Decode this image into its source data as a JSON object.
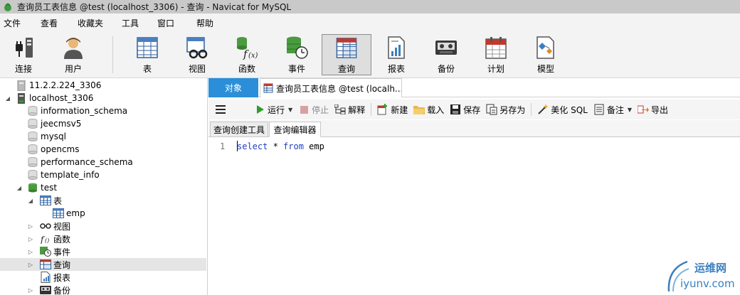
{
  "window": {
    "title": "查询员工表信息 @test (localhost_3306) - 查询 - Navicat for MySQL"
  },
  "menu": [
    "文件",
    "查看",
    "收藏夹",
    "工具",
    "窗口",
    "帮助"
  ],
  "ribbon": [
    {
      "label": "连接",
      "icon": "plug-icon"
    },
    {
      "label": "用户",
      "icon": "user-icon"
    },
    {
      "label": "表",
      "icon": "table-icon"
    },
    {
      "label": "视图",
      "icon": "view-icon"
    },
    {
      "label": "函数",
      "icon": "function-icon"
    },
    {
      "label": "事件",
      "icon": "event-icon"
    },
    {
      "label": "查询",
      "icon": "query-icon",
      "active": true
    },
    {
      "label": "报表",
      "icon": "report-icon"
    },
    {
      "label": "备份",
      "icon": "backup-icon"
    },
    {
      "label": "计划",
      "icon": "schedule-icon"
    },
    {
      "label": "模型",
      "icon": "model-icon"
    }
  ],
  "tree": [
    {
      "label": "11.2.2.224_3306",
      "icon": "server-icon",
      "level": 0,
      "arrow": ""
    },
    {
      "label": "localhost_3306",
      "icon": "server-connected-icon",
      "level": 0,
      "arrow": "expanded"
    },
    {
      "label": "information_schema",
      "icon": "database-icon",
      "level": 1,
      "arrow": ""
    },
    {
      "label": "jeecmsv5",
      "icon": "database-icon",
      "level": 1,
      "arrow": ""
    },
    {
      "label": "mysql",
      "icon": "database-icon",
      "level": 1,
      "arrow": ""
    },
    {
      "label": "opencms",
      "icon": "database-icon",
      "level": 1,
      "arrow": ""
    },
    {
      "label": "performance_schema",
      "icon": "database-icon",
      "level": 1,
      "arrow": ""
    },
    {
      "label": "template_info",
      "icon": "database-icon",
      "level": 1,
      "arrow": ""
    },
    {
      "label": "test",
      "icon": "database-open-icon",
      "level": 1,
      "arrow": "expanded"
    },
    {
      "label": "表",
      "icon": "table-icon",
      "level": 2,
      "arrow": "expanded"
    },
    {
      "label": "emp",
      "icon": "table-icon",
      "level": 3,
      "arrow": ""
    },
    {
      "label": "视图",
      "icon": "view-icon",
      "level": 2,
      "arrow": "collapsed"
    },
    {
      "label": "函数",
      "icon": "function-icon",
      "level": 2,
      "arrow": "collapsed"
    },
    {
      "label": "事件",
      "icon": "event-icon",
      "level": 2,
      "arrow": "collapsed"
    },
    {
      "label": "查询",
      "icon": "query-icon",
      "level": 2,
      "arrow": "collapsed",
      "selected": true
    },
    {
      "label": "报表",
      "icon": "report-icon",
      "level": 2,
      "arrow": ""
    },
    {
      "label": "备份",
      "icon": "backup-icon",
      "level": 2,
      "arrow": "collapsed"
    }
  ],
  "tabs": {
    "objects": "对象",
    "query": "查询员工表信息 @test (localh..."
  },
  "query_toolbar": {
    "menu_icon": "hamburger-icon",
    "run": "运行",
    "stop": "停止",
    "explain": "解释",
    "new": "新建",
    "load": "载入",
    "save": "保存",
    "save_as": "另存为",
    "beautify": "美化 SQL",
    "comment": "备注",
    "export": "导出"
  },
  "subtabs": {
    "builder": "查询创建工具",
    "editor": "查询编辑器"
  },
  "editor": {
    "line_number": "1",
    "tokens": {
      "select": "select",
      "star": " * ",
      "from": "from",
      "table": " emp"
    }
  },
  "watermark": {
    "line1": "运维网",
    "line2": "iyunv.com"
  },
  "colors": {
    "accent": "#2a8fd8",
    "keyword": "#1f3fbf"
  }
}
